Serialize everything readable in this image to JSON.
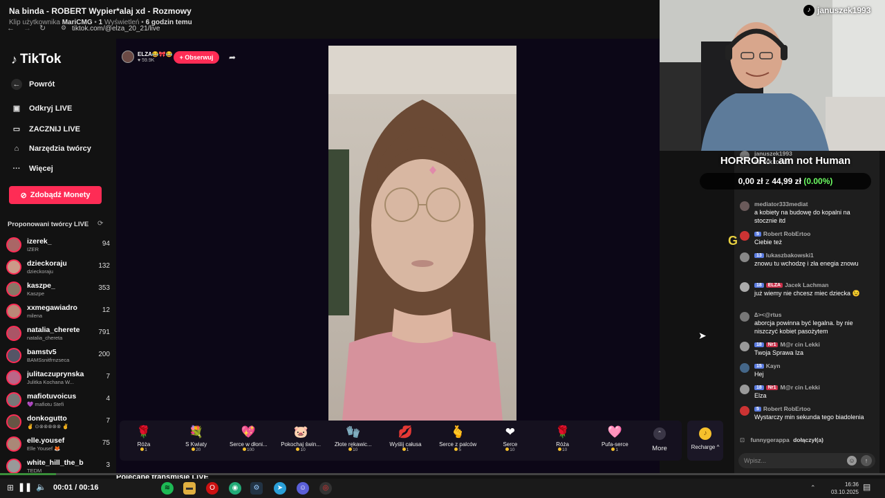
{
  "window": {
    "title": "Na binda - ROBERT Wypier*alaj xd - Rozmowy",
    "meta_prefix": "Klip użytkownika",
    "meta_user": "MariCMG",
    "meta_views": "1",
    "meta_views_label": "Wyświetleń",
    "meta_time": "6 godzin temu",
    "url": "tiktok.com/@elza_20_21/live"
  },
  "sidebar": {
    "logo": "TikTok",
    "back": "Powrót",
    "items": [
      {
        "icon": "calendar-live-icon",
        "label": "Odkryj LIVE"
      },
      {
        "icon": "camera-icon",
        "label": "ZACZNIJ LIVE"
      },
      {
        "icon": "home-tools-icon",
        "label": "Narzędzia twórcy"
      },
      {
        "icon": "more-dots-icon",
        "label": "Więcej"
      }
    ],
    "coins_button": "Zdobądź Monety",
    "suggested_title": "Proponowani twórcy LIVE",
    "creators": [
      {
        "name": "izerek_",
        "sub": "IZER",
        "viewers": "94",
        "color": "#a66"
      },
      {
        "name": "dzieckoraju",
        "sub": "dzieckoraju",
        "viewers": "132",
        "color": "#c98"
      },
      {
        "name": "kaszpe_",
        "sub": "Kaszpe",
        "viewers": "353",
        "color": "#876"
      },
      {
        "name": "xxmegawiadro",
        "sub": "milena",
        "viewers": "12",
        "color": "#b87"
      },
      {
        "name": "natalia_cherete",
        "sub": "natalia_chereta",
        "viewers": "791",
        "color": "#a56"
      },
      {
        "name": "bamstv5",
        "sub": "BAMSsnitfrnzseca",
        "viewers": "200",
        "color": "#556"
      },
      {
        "name": "julitaczuprynska",
        "sub": "Julitka Kochana W...",
        "viewers": "7",
        "color": "#b68"
      },
      {
        "name": "mafiotuvoicus",
        "sub": "💜 mafiotu Stefi",
        "viewers": "4",
        "color": "#777"
      },
      {
        "name": "donkogutto",
        "sub": "✌ ⊙⊗⊗⊗⊗⊗ ✌",
        "viewers": "7",
        "color": "#654"
      },
      {
        "name": "elle.yousef",
        "sub": "Elle Yousef 🦊",
        "viewers": "75",
        "color": "#a87"
      },
      {
        "name": "white_hill_the_b",
        "sub": "TEDM",
        "viewers": "3",
        "color": "#999"
      }
    ]
  },
  "stream": {
    "host_name": "ELZA😂🎀😂",
    "host_likes": "♥ 59.9K",
    "follow": "+ Obserwuj",
    "recommended": "Polecane transmisje LIVE"
  },
  "gifts": [
    {
      "icon": "🌹",
      "name": "Róża",
      "price": "1"
    },
    {
      "icon": "💐",
      "name": "S Kwiaty",
      "price": "20"
    },
    {
      "icon": "💖",
      "name": "Serce w dłoni...",
      "price": "100"
    },
    {
      "icon": "🐷",
      "name": "Pokochaj świn...",
      "price": "10"
    },
    {
      "icon": "🧤",
      "name": "Złote rękawic...",
      "price": "10"
    },
    {
      "icon": "💋",
      "name": "Wyślij całusa",
      "price": "1"
    },
    {
      "icon": "🫰",
      "name": "Serce z palców",
      "price": "5"
    },
    {
      "icon": "❤",
      "name": "Serce",
      "price": "10"
    },
    {
      "icon": "🌹",
      "name": "Róża",
      "price": "10"
    },
    {
      "icon": "🩷",
      "name": "Pufa-serce",
      "price": "1"
    }
  ],
  "more_label": "More",
  "recharge_label": "Recharge ^",
  "chat": {
    "messages": [
      {
        "badges": [],
        "user": "januszek1993",
        "text": "na tick tock?",
        "avatar": "#777"
      },
      {
        "badges": [],
        "user": "mediator333mediat",
        "text": "a kobiety na budowę do kopalni na stocznie itd",
        "avatar": "#6a5a5a"
      },
      {
        "badges": [
          "5"
        ],
        "user": "Robert RobErtoo",
        "text": "Ciebie też",
        "avatar": "#c33"
      },
      {
        "badges": [
          "13"
        ],
        "user": "lukaszbakowski1",
        "text": "znowu tu wchodzę i zła enegia znowu",
        "avatar": "#888"
      },
      {
        "badges": [
          "18",
          "ELZA"
        ],
        "user": "Jacek Lachman",
        "text": "już wiemy nie chcesz miec dziecka 😉",
        "avatar": "#aaa"
      },
      {
        "badges": [],
        "user": "∆><@rtus",
        "text": "aborcja powinna być legalna. by nie niszczyć kobiet pasożytem",
        "avatar": "#777"
      },
      {
        "badges": [
          "18",
          "Nr1"
        ],
        "user": "M@r cin Lekki",
        "text": "Twoja Sprawa Iza",
        "avatar": "#999"
      },
      {
        "badges": [
          "15"
        ],
        "user": "Kayn",
        "text": "Hej",
        "avatar": "#468"
      },
      {
        "badges": [
          "18",
          "Nr1"
        ],
        "user": "M@r cin Lekki",
        "text": "Elza",
        "avatar": "#999"
      },
      {
        "badges": [
          "5"
        ],
        "user": "Robert RobErtoo",
        "text": "Wystarczy min sekunda tego biadolenia",
        "avatar": "#c33"
      }
    ],
    "join_user": "funnygerappa",
    "join_text": "dołączył(a)",
    "input_placeholder": "Wpisz..."
  },
  "overlay": {
    "cam_handle": "januszek1993",
    "horror_title": "HORROR: I am not Human",
    "donation_current": "0,00 zł",
    "donation_of": "z",
    "donation_goal": "44,99 zł",
    "donation_pct": "(0.00%)",
    "g_letter": "G"
  },
  "player": {
    "time": "00:01 / 00:16",
    "progress": 0.063
  },
  "taskbar": {
    "clock_time": "16:36",
    "clock_date": "03.10.2025"
  }
}
